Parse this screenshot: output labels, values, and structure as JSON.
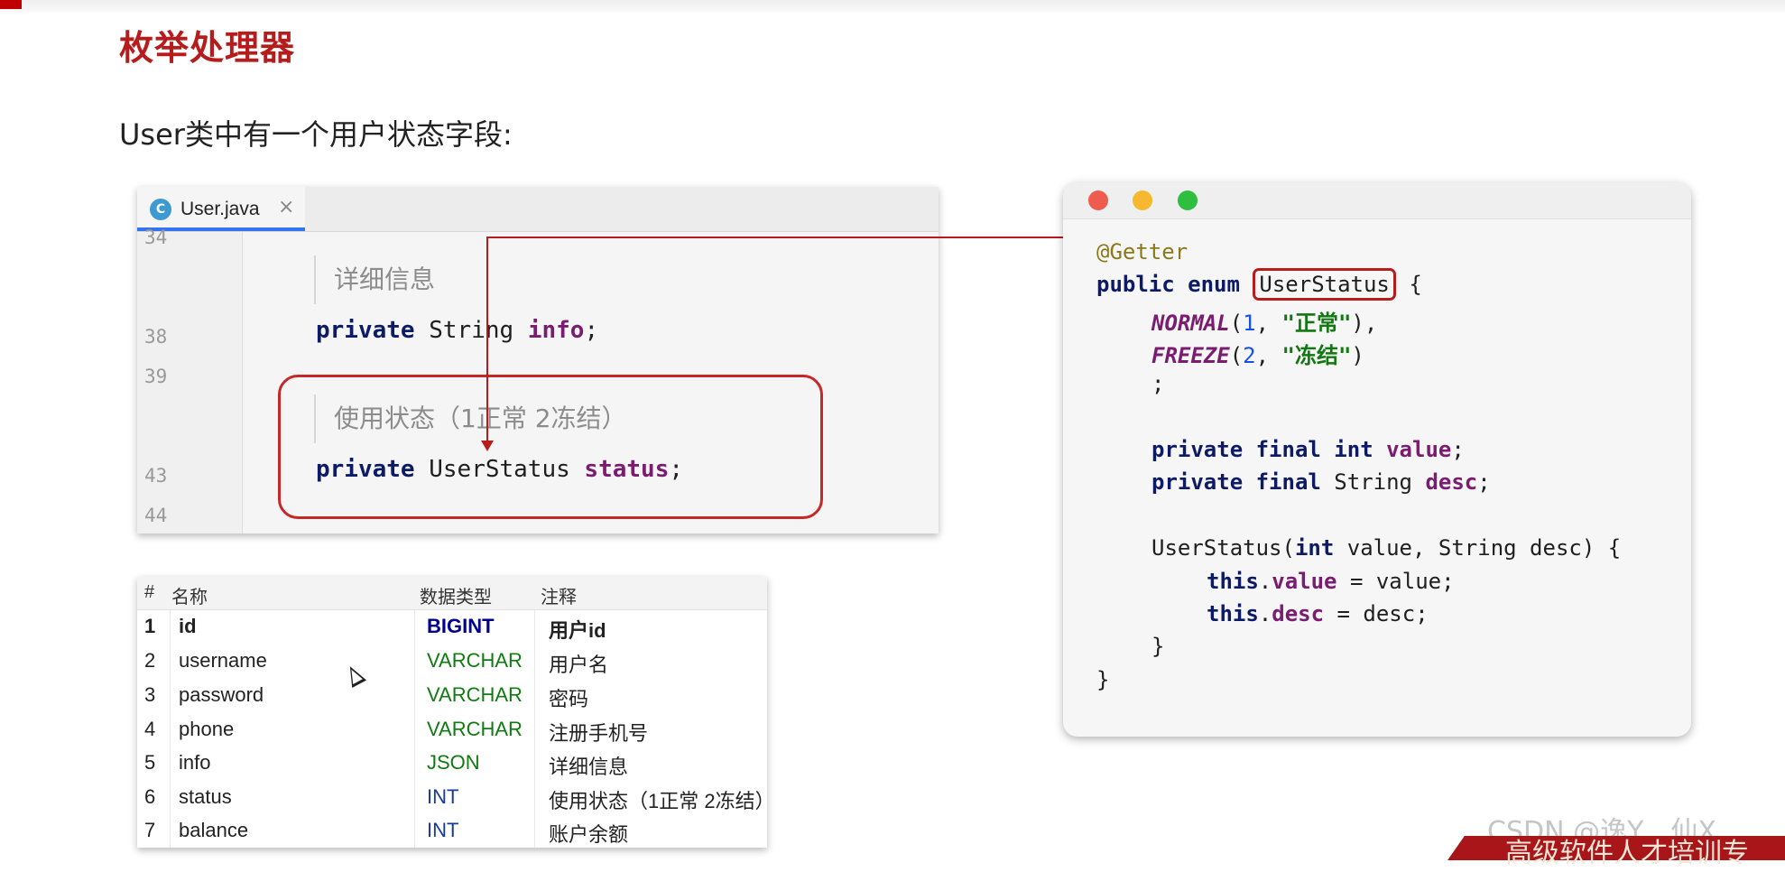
{
  "slide": {
    "title": "枚举处理器",
    "subtitle": "User类中有一个用户状态字段:"
  },
  "ide": {
    "tab_icon_letter": "C",
    "tab_label": "User.java",
    "tab_close": "×",
    "line_numbers": [
      "34",
      "38",
      "39",
      "43",
      "44"
    ],
    "doc_comment_1": "详细信息",
    "code_line_38": {
      "kw": "private",
      "type": " String ",
      "field": "info",
      "end": ";"
    },
    "doc_comment_2": "使用状态（1正常 2冻结）",
    "code_line_43": {
      "kw": "private",
      "type": " UserStatus ",
      "field": "status",
      "end": ";"
    }
  },
  "db_table": {
    "headers": {
      "index": "#",
      "name": "名称",
      "type": "数据类型",
      "comment": "注释"
    },
    "rows": [
      {
        "index": "1",
        "name": "id",
        "type": "BIGINT",
        "comment": "用户id"
      },
      {
        "index": "2",
        "name": "username",
        "type": "VARCHAR",
        "comment": "用户名"
      },
      {
        "index": "3",
        "name": "password",
        "type": "VARCHAR",
        "comment": "密码"
      },
      {
        "index": "4",
        "name": "phone",
        "type": "VARCHAR",
        "comment": "注册手机号"
      },
      {
        "index": "5",
        "name": "info",
        "type": "JSON",
        "comment": "详细信息"
      },
      {
        "index": "6",
        "name": "status",
        "type": "INT",
        "comment": "使用状态（1正常 2冻结）"
      },
      {
        "index": "7",
        "name": "balance",
        "type": "INT",
        "comment": "账户余额"
      }
    ]
  },
  "enum_code": {
    "annotation": "@Getter",
    "decl_kw": "public enum ",
    "class_name": "UserStatus",
    "brace_open": " {",
    "normal": {
      "name": "NORMAL",
      "open": "(",
      "num": "1",
      "sep": ", ",
      "str": "\"正常\"",
      "close": "),"
    },
    "freeze": {
      "name": "FREEZE",
      "open": "(",
      "num": "2",
      "sep": ", ",
      "str": "\"冻结\"",
      "close": ")"
    },
    "semicolon": ";",
    "field1": {
      "kw": "private final int ",
      "name": "value",
      "end": ";"
    },
    "field2": {
      "kw": "private final ",
      "type": "String ",
      "name": "desc",
      "end": ";"
    },
    "ctor": {
      "name": "UserStatus(",
      "kw1": "int",
      "rest": " value, String desc) {"
    },
    "assign1": {
      "this": "this",
      "dot": ".",
      "field": "value",
      "rest": " = value;"
    },
    "assign2": {
      "this": "this",
      "dot": ".",
      "field": "desc",
      "rest": " = desc;"
    },
    "inner_close": "}",
    "outer_close": "}"
  },
  "watermark": "CSDN @逸Y__仙X",
  "banner": "高级软件人才培训专"
}
